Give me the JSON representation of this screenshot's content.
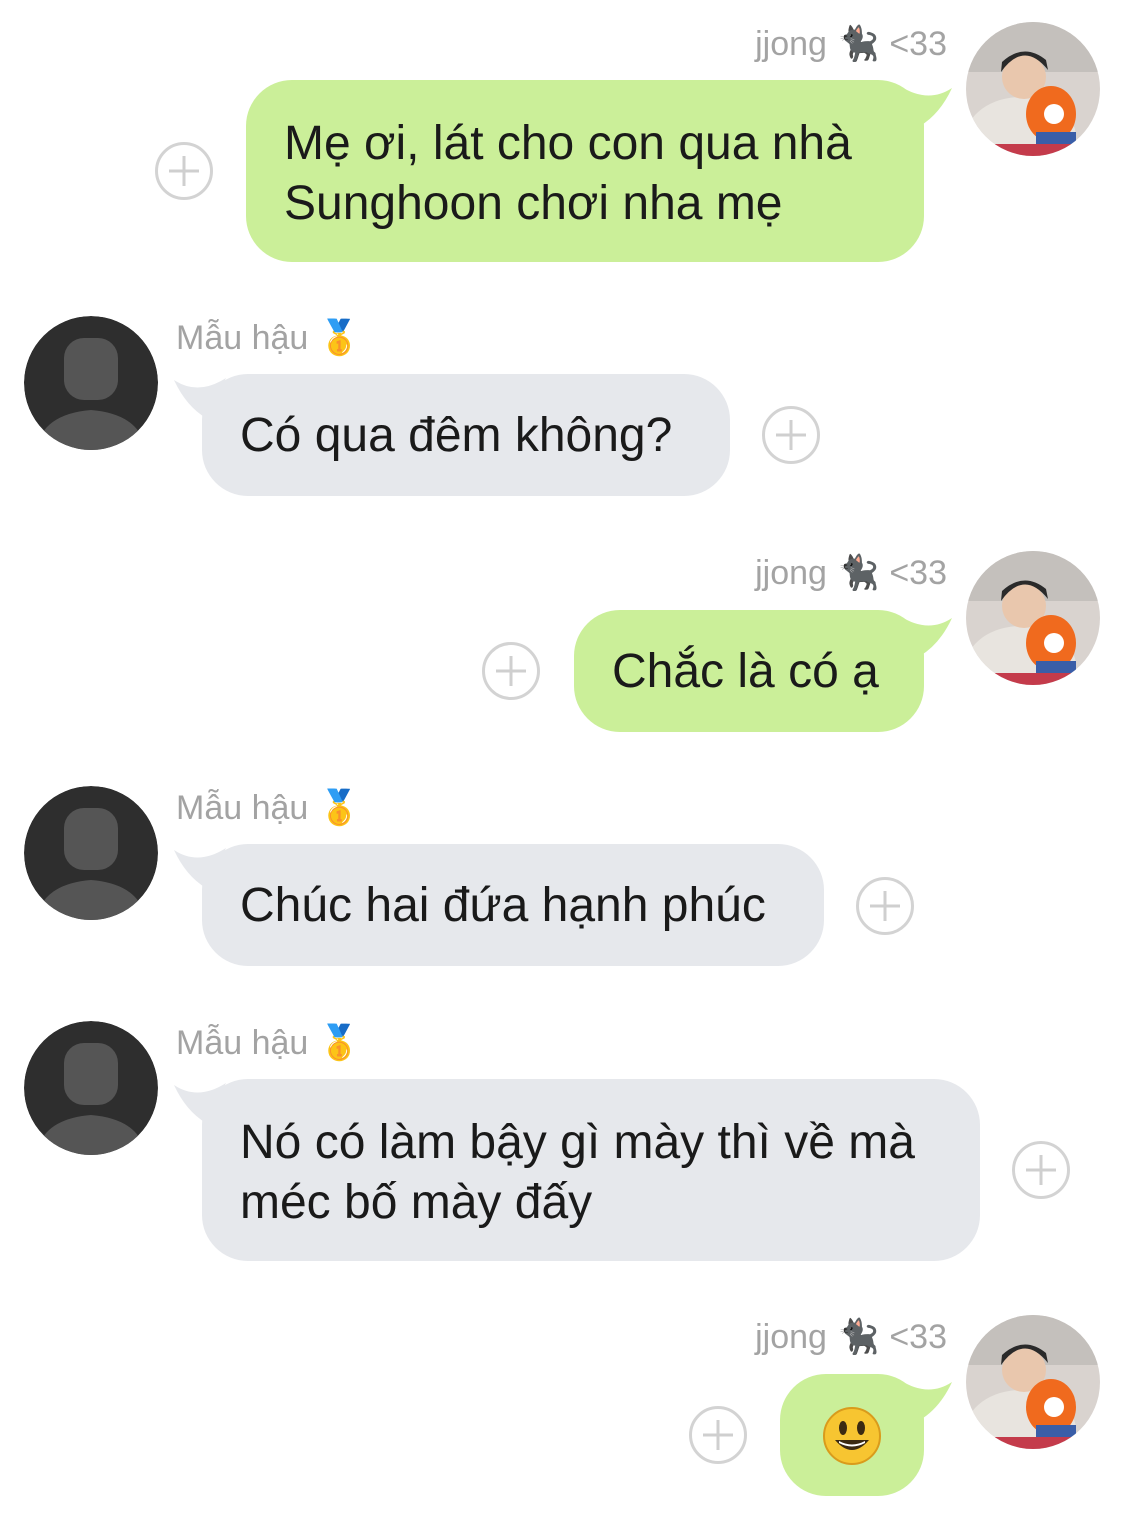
{
  "colors": {
    "outgoing_bubble": "#cbef99",
    "incoming_bubble": "#e6e8ec",
    "name_text": "#a3a3a3",
    "message_text": "#1a1a1a"
  },
  "messages": [
    {
      "direction": "outgoing",
      "sender": "jjong",
      "sender_emoji": "🐈‍⬛",
      "sender_suffix": "<33",
      "text": "Mẹ ơi, lát cho con qua nhà\nSunghoon chơi nha mẹ",
      "avatar": "user-photo-avatar"
    },
    {
      "direction": "incoming",
      "sender": "Mẫu hậu",
      "sender_emoji": "🥇",
      "text": "Có qua đêm không?",
      "avatar": "default-person-avatar"
    },
    {
      "direction": "outgoing",
      "sender": "jjong",
      "sender_emoji": "🐈‍⬛",
      "sender_suffix": "<33",
      "text": "Chắc là có ạ",
      "avatar": "user-photo-avatar"
    },
    {
      "direction": "incoming",
      "sender": "Mẫu hậu",
      "sender_emoji": "🥇",
      "text": "Chúc hai đứa hạnh phúc",
      "avatar": "default-person-avatar"
    },
    {
      "direction": "incoming",
      "sender": "Mẫu hậu",
      "sender_emoji": "🥇",
      "text": "Nó có làm bậy gì mày thì về mà\nméc bố mày đấy",
      "avatar": "default-person-avatar"
    },
    {
      "direction": "outgoing",
      "sender": "jjong",
      "sender_emoji": "🐈‍⬛",
      "sender_suffix": "<33",
      "text": "",
      "sticker": "smiley-emoji",
      "avatar": "user-photo-avatar"
    }
  ]
}
